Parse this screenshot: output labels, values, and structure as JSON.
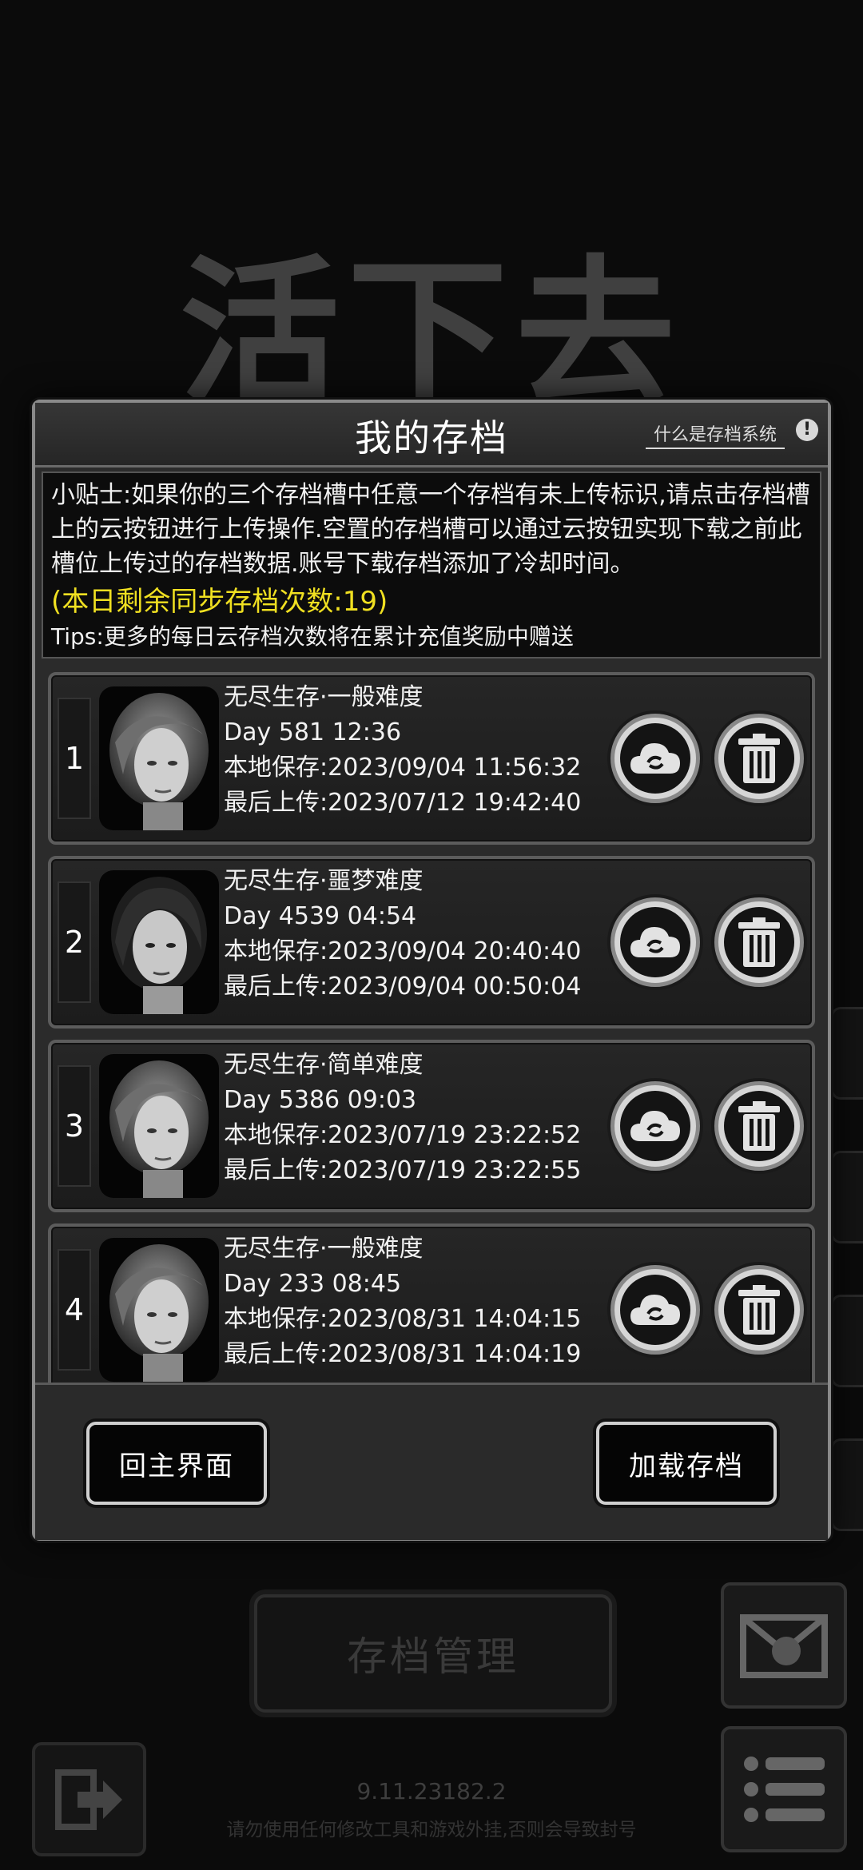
{
  "background": {
    "game_title": "活下去",
    "manage_label": "存档管理",
    "version": "9.11.23182.2",
    "warning": "请勿使用任何修改工具和游戏外挂,否则会导致封号"
  },
  "modal": {
    "title": "我的存档",
    "help_link": "什么是存档系统",
    "help_icon": "!",
    "tips_text": "小贴士:如果你的三个存档槽中任意一个存档有未上传标识,请点击存档槽上的云按钮进行上传操作.空置的存档槽可以通过云按钮实现下载之前此槽位上传过的存档数据.账号下载存档添加了冷却时间。",
    "sync_remaining": "(本日剩余同步存档次数:19)",
    "tips_extra": "Tips:更多的每日云存档次数将在累计充值奖励中赠送",
    "home_button": "回主界面",
    "load_button": "加载存档"
  },
  "slots": [
    {
      "num": "1",
      "mode": "无尽生存·一般难度",
      "day": "Day 581  12:36",
      "local_save": "本地保存:2023/09/04  11:56:32",
      "last_upload": "最后上传:2023/07/12  19:42:40",
      "portrait": "female-gray-hair"
    },
    {
      "num": "2",
      "mode": "无尽生存·噩梦难度",
      "day": "Day 4539  04:54",
      "local_save": "本地保存:2023/09/04  20:40:40",
      "last_upload": "最后上传:2023/09/04  00:50:04",
      "portrait": "female-dark-hair"
    },
    {
      "num": "3",
      "mode": "无尽生存·简单难度",
      "day": "Day 5386  09:03",
      "local_save": "本地保存:2023/07/19  23:22:52",
      "last_upload": "最后上传:2023/07/19  23:22:55",
      "portrait": "female-gray-hair"
    },
    {
      "num": "4",
      "mode": "无尽生存·一般难度",
      "day": "Day 233  08:45",
      "local_save": "本地保存:2023/08/31  14:04:15",
      "last_upload": "最后上传:2023/08/31  14:04:19",
      "portrait": "female-gray-hair"
    }
  ],
  "icons": {
    "cloud": "cloud-sync-icon",
    "trash": "trash-icon",
    "exit": "exit-icon",
    "mail": "mail-icon",
    "menu": "menu-icon"
  },
  "colors": {
    "highlight": "#f0e021",
    "modal_bg": "#2b2b2b",
    "border": "#8a8a8a"
  }
}
